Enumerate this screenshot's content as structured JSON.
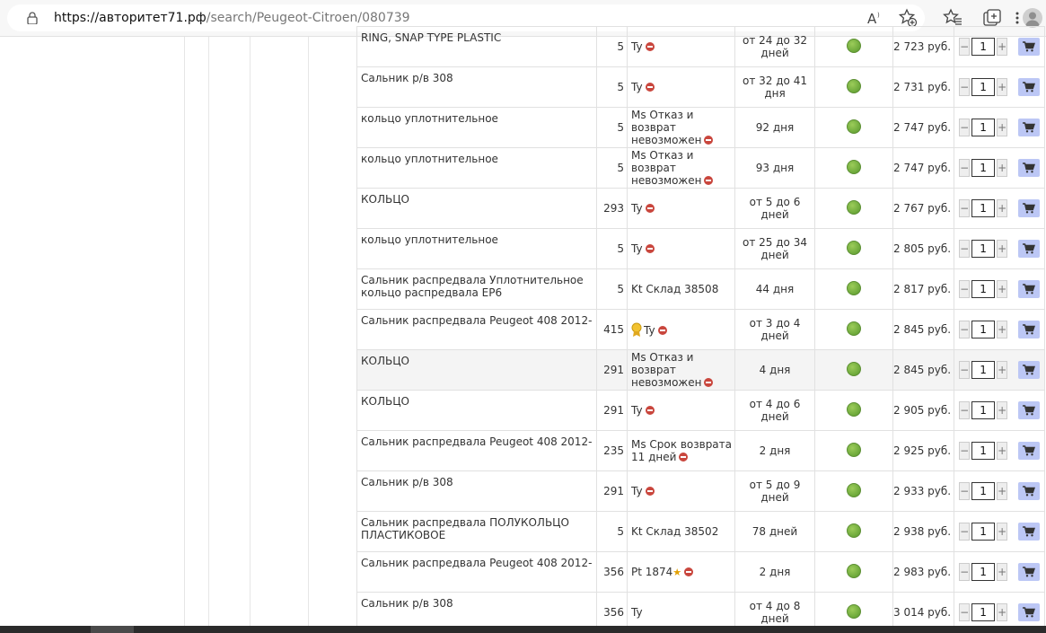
{
  "browser": {
    "url_domain": "https://авторитет71.рф",
    "url_path": "/search/Peugeot-Citroen/080739",
    "icons": [
      "lock-icon",
      "read-aloud-icon",
      "add-favorite-icon",
      "favorites-icon",
      "collections-icon",
      "more-icon",
      "profile-icon"
    ]
  },
  "rows": [
    {
      "name": "RING, SNAP TYPE PLASTIC",
      "qty": "5",
      "supplier": "Ty",
      "stop": true,
      "delivery": "от 24 до 32 дней",
      "price": "2 723 руб.",
      "count": "1"
    },
    {
      "name": "Сальник р/в 308",
      "qty": "5",
      "supplier": "Ty",
      "stop": true,
      "delivery": "от 32 до 41 дня",
      "price": "2 731 руб.",
      "count": "1"
    },
    {
      "name": "кольцо уплотнительное",
      "qty": "5",
      "supplier": "Ms Отказ и возврат невозможен",
      "stop": true,
      "delivery": "92 дня",
      "price": "2 747 руб.",
      "count": "1"
    },
    {
      "name": "кольцо уплотнительное",
      "qty": "5",
      "supplier": "Ms Отказ и возврат невозможен",
      "stop": true,
      "delivery": "93 дня",
      "price": "2 747 руб.",
      "count": "1"
    },
    {
      "name": "КОЛЬЦО",
      "qty": "293",
      "supplier": "Ty",
      "stop": true,
      "delivery": "от 5 до 6 дней",
      "price": "2 767 руб.",
      "count": "1"
    },
    {
      "name": "кольцо уплотнительное",
      "qty": "5",
      "supplier": "Ty",
      "stop": true,
      "delivery": "от 25 до 34 дней",
      "price": "2 805 руб.",
      "count": "1"
    },
    {
      "name": "Сальник распредвала Уплотнительное кольцо распредвала EP6",
      "qty": "5",
      "supplier": "Kt Склад 38508",
      "stop": false,
      "delivery": "44 дня",
      "price": "2 817 руб.",
      "count": "1"
    },
    {
      "name": "Сальник распредвала Peugeot 408 2012-",
      "qty": "415",
      "supplier": "Ty",
      "stop": true,
      "medal": true,
      "delivery": "от 3 до 4 дней",
      "price": "2 845 руб.",
      "count": "1"
    },
    {
      "name": "КОЛЬЦО",
      "qty": "291",
      "supplier": "Ms Отказ и возврат невозможен",
      "stop": true,
      "delivery": "4 дня",
      "price": "2 845 руб.",
      "count": "1",
      "highlight": true
    },
    {
      "name": "КОЛЬЦО",
      "qty": "291",
      "supplier": "Ty",
      "stop": true,
      "delivery": "от 4 до 6 дней",
      "price": "2 905 руб.",
      "count": "1"
    },
    {
      "name": "Сальник распредвала Peugeot 408 2012-",
      "qty": "235",
      "supplier": "Ms Срок возврата 11 дней",
      "stop": true,
      "delivery": "2 дня",
      "price": "2 925 руб.",
      "count": "1"
    },
    {
      "name": "Сальник р/в 308",
      "qty": "291",
      "supplier": "Ty",
      "stop": true,
      "delivery": "от 5 до 9 дней",
      "price": "2 933 руб.",
      "count": "1"
    },
    {
      "name": "Сальник распредвала ПОЛУКОЛЬЦО ПЛАСТИКОВОЕ",
      "qty": "5",
      "supplier": "Kt Склад 38502",
      "stop": false,
      "delivery": "78 дней",
      "price": "2 938 руб.",
      "count": "1"
    },
    {
      "name": "Сальник распредвала Peugeot 408 2012-",
      "qty": "356",
      "supplier": "Pt 1874",
      "star": "★",
      "stop": true,
      "delivery": "2 дня",
      "price": "2 983 руб.",
      "count": "1"
    },
    {
      "name": "Сальник р/в 308",
      "qty": "356",
      "supplier": "Ty",
      "stop": false,
      "delivery": "от 4 до 8 дней",
      "price": "3 014 руб.",
      "count": "1"
    }
  ],
  "controls": {
    "minus": "−",
    "plus": "+"
  },
  "colors": {
    "availability": "#6ca83a",
    "cart_button": "#bcc7f5",
    "stop": "#c9463d"
  }
}
